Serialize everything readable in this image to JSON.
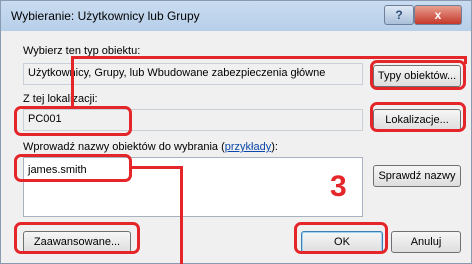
{
  "window": {
    "title": "Wybieranie: Użytkownicy lub Grupy",
    "help_label": "?",
    "close_label": "x"
  },
  "object_type": {
    "label": "Wybierz ten typ obiektu:",
    "value": "Użytkownicy, Grupy, lub Wbudowane zabezpieczenia główne",
    "button": "Typy obiektów..."
  },
  "location": {
    "label": "Z tej lokalizacji:",
    "value": "PC001",
    "button": "Lokalizacje..."
  },
  "names": {
    "label_prefix": "Wprowadź nazwy obiektów do wybrania (",
    "link": "przykłady",
    "label_suffix": "):",
    "value": "james.smith",
    "check_button": "Sprawdź nazwy"
  },
  "footer": {
    "advanced_button": "Zaawansowane...",
    "ok_button": "OK",
    "cancel_button": "Anuluj"
  },
  "annotation": {
    "step": "3",
    "color": "#e4262a"
  }
}
